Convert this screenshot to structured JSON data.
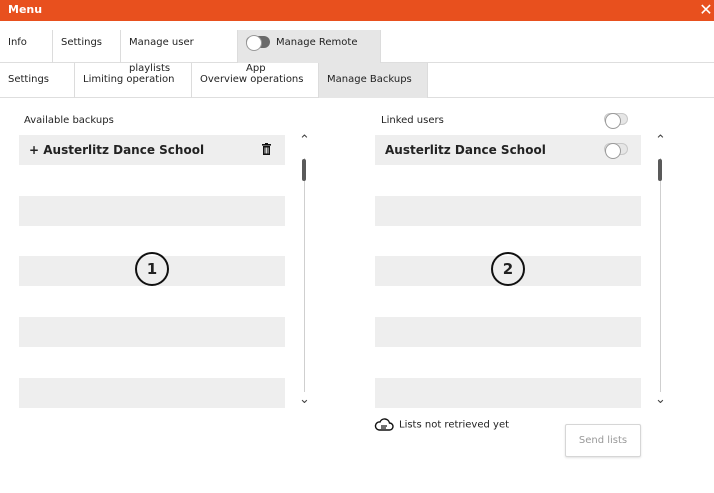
{
  "window": {
    "title": "Menu",
    "close_glyph": "✕",
    "accent": "#e8501e"
  },
  "top_tabs": [
    {
      "label": "Info"
    },
    {
      "label": "Settings"
    },
    {
      "label": "Manage user playlists"
    },
    {
      "label": "Manage Remote App",
      "toggle": "off"
    }
  ],
  "sub_tabs": [
    {
      "label": "Settings"
    },
    {
      "label": "Limiting operation"
    },
    {
      "label": "Overview operations"
    },
    {
      "label": "Manage Backups",
      "active": true
    }
  ],
  "backups": {
    "label": "Available backups",
    "items": [
      {
        "text": "+ Austerlitz Dance School",
        "icon": "trash-icon"
      }
    ],
    "marker": "1"
  },
  "linked": {
    "label": "Linked users",
    "items": [
      {
        "text": "Austerlitz Dance School",
        "toggle": "off"
      }
    ],
    "marker": "2"
  },
  "scroll": {
    "up": "⌃",
    "down": "⌄"
  },
  "status": {
    "text": "Lists not retrieved yet",
    "icon": "cloud-icon"
  },
  "send_button": {
    "label": "Send lists"
  }
}
